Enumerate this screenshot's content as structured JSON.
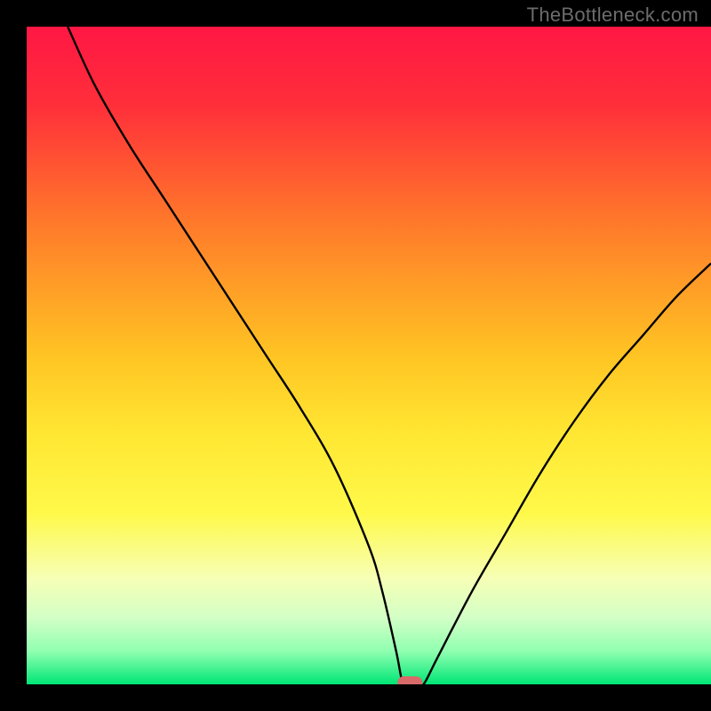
{
  "watermark": "TheBottleneck.com",
  "chart_data": {
    "type": "line",
    "title": "",
    "xlabel": "",
    "ylabel": "",
    "xlim": [
      0,
      100
    ],
    "ylim": [
      0,
      100
    ],
    "x": [
      6,
      10,
      15,
      20,
      25,
      30,
      35,
      40,
      45,
      50,
      52,
      54,
      55,
      56,
      57,
      58,
      60,
      65,
      70,
      75,
      80,
      85,
      90,
      95,
      100
    ],
    "values": [
      100,
      91,
      82,
      74,
      66,
      58,
      50,
      42,
      33,
      21,
      14,
      5,
      0,
      0,
      0,
      0,
      4,
      14,
      23,
      32,
      40,
      47,
      53,
      59,
      64
    ],
    "marker": {
      "x": 56,
      "y": 0
    },
    "background_gradient": {
      "stops": [
        {
          "offset": 0.0,
          "color": "#ff1744"
        },
        {
          "offset": 0.12,
          "color": "#ff2f3a"
        },
        {
          "offset": 0.3,
          "color": "#ff7a2a"
        },
        {
          "offset": 0.5,
          "color": "#ffc423"
        },
        {
          "offset": 0.62,
          "color": "#ffe733"
        },
        {
          "offset": 0.74,
          "color": "#fff94a"
        },
        {
          "offset": 0.84,
          "color": "#f6ffb6"
        },
        {
          "offset": 0.9,
          "color": "#d2ffc6"
        },
        {
          "offset": 0.95,
          "color": "#8fffb0"
        },
        {
          "offset": 1.0,
          "color": "#00e676"
        }
      ]
    }
  }
}
